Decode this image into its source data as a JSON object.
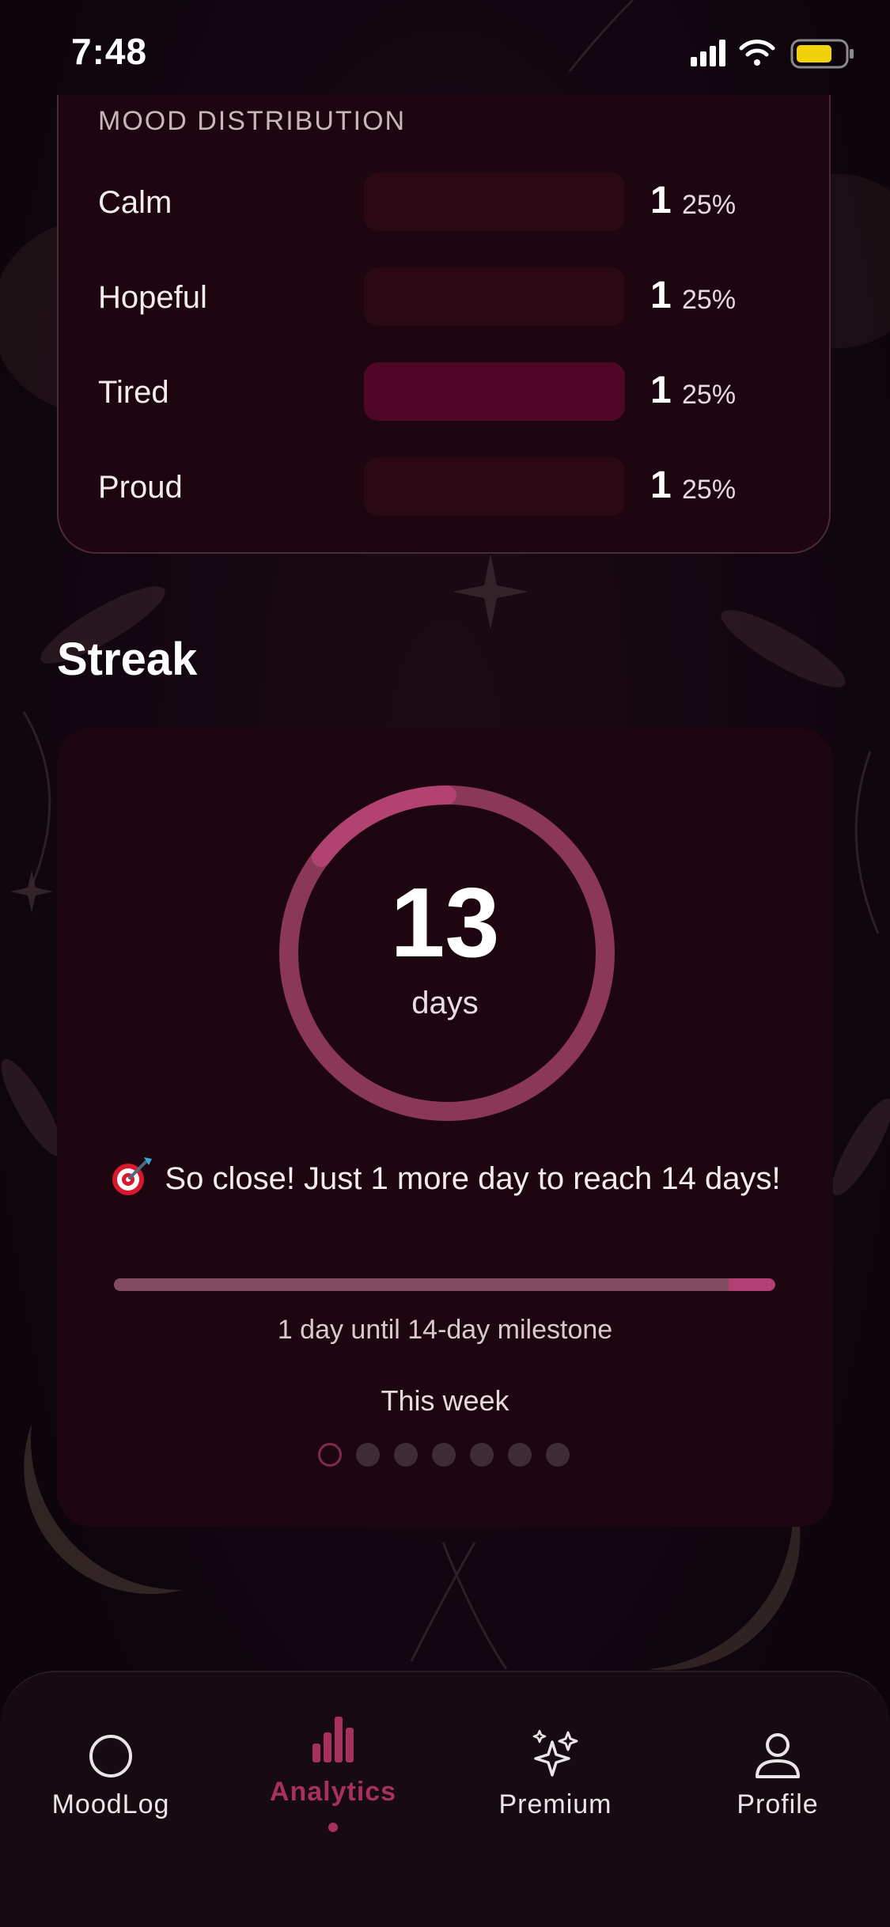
{
  "status_bar": {
    "time": "7:48"
  },
  "mood_distribution": {
    "title": "MOOD DISTRIBUTION",
    "rows": [
      {
        "label": "Calm",
        "count": "1",
        "percent": "25%"
      },
      {
        "label": "Hopeful",
        "count": "1",
        "percent": "25%"
      },
      {
        "label": "Tired",
        "count": "1",
        "percent": "25%",
        "highlighted": true
      },
      {
        "label": "Proud",
        "count": "1",
        "percent": "25%"
      }
    ]
  },
  "streak": {
    "section_title": "Streak",
    "days_count": "13",
    "days_unit": "days",
    "message": "So close! Just 1 more day to reach 14 days!",
    "message_icon": "dart-target-icon",
    "progress_fraction": 0.929,
    "progress_caption": "1 day until 14-day milestone",
    "week_label": "This week",
    "week_days_filled": [
      false,
      false,
      false,
      false,
      false,
      false,
      false
    ]
  },
  "tab_bar": {
    "active_tab": "Analytics",
    "tabs": [
      {
        "label": "MoodLog",
        "icon": "circle-icon"
      },
      {
        "label": "Analytics",
        "icon": "bar-chart-icon"
      },
      {
        "label": "Premium",
        "icon": "sparkles-icon"
      },
      {
        "label": "Profile",
        "icon": "person-icon"
      }
    ]
  },
  "colors": {
    "accent": "#a8305f",
    "card_background": "#1d0610",
    "page_background": "#120610"
  }
}
